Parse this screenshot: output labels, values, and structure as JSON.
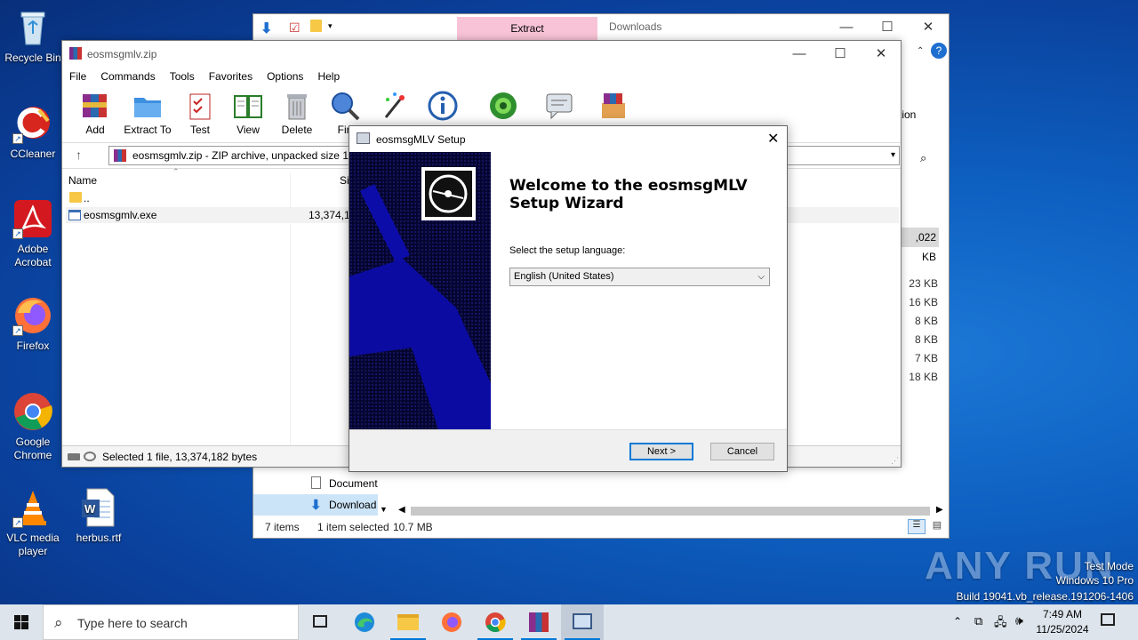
{
  "desktop": {
    "icons": [
      {
        "label": "Recycle Bin"
      },
      {
        "label": "CCleaner"
      },
      {
        "label": "Adobe Acrobat"
      },
      {
        "label": "Firefox"
      },
      {
        "label": "Google Chrome"
      },
      {
        "label": "VLC media player"
      },
      {
        "label": "herbus.rtf"
      }
    ]
  },
  "explorer": {
    "ribbon_tab": "Extract",
    "title": "Downloads",
    "partial_ribbon_text": "tion",
    "selected_size": ",022 KB",
    "sizes": [
      "23 KB",
      "16 KB",
      "8 KB",
      "8 KB",
      "7 KB",
      "18 KB"
    ],
    "nav_items": [
      "Document",
      "Download"
    ],
    "status": {
      "items": "7 items",
      "selected": "1 item selected",
      "size": "10.7 MB"
    }
  },
  "winrar": {
    "title": "eosmsgmlv.zip",
    "menu": [
      "File",
      "Commands",
      "Tools",
      "Favorites",
      "Options",
      "Help"
    ],
    "toolbar": [
      "Add",
      "Extract To",
      "Test",
      "View",
      "Delete",
      "Fin"
    ],
    "address": "eosmsgmlv.zip - ZIP archive, unpacked size 13",
    "columns": {
      "name": "Name",
      "size": "Siz"
    },
    "rows": [
      {
        "name": "..",
        "size": ""
      },
      {
        "name": "eosmsgmlv.exe",
        "size": "13,374,18"
      }
    ],
    "status": "Selected 1 file, 13,374,182 bytes"
  },
  "setup": {
    "title": "eosmsgMLV Setup",
    "heading_line1": "Welcome to the eosmsgMLV",
    "heading_line2": "Setup Wizard",
    "lang_label": "Select the setup language:",
    "lang_value": "English (United States)",
    "next": "Next >",
    "cancel": "Cancel"
  },
  "taskbar": {
    "search_placeholder": "Type here to search",
    "time": "7:49 AM",
    "date": "11/25/2024"
  },
  "watermark": {
    "brand": "ANY RUN",
    "mode": "Test Mode",
    "os": "Windows 10 Pro",
    "build": "Build 19041.vb_release.191206-1406"
  },
  "colors": {
    "accent": "#0078d7",
    "ribbon_context": "#f8c3d6",
    "banner": "#0a0a5e"
  }
}
